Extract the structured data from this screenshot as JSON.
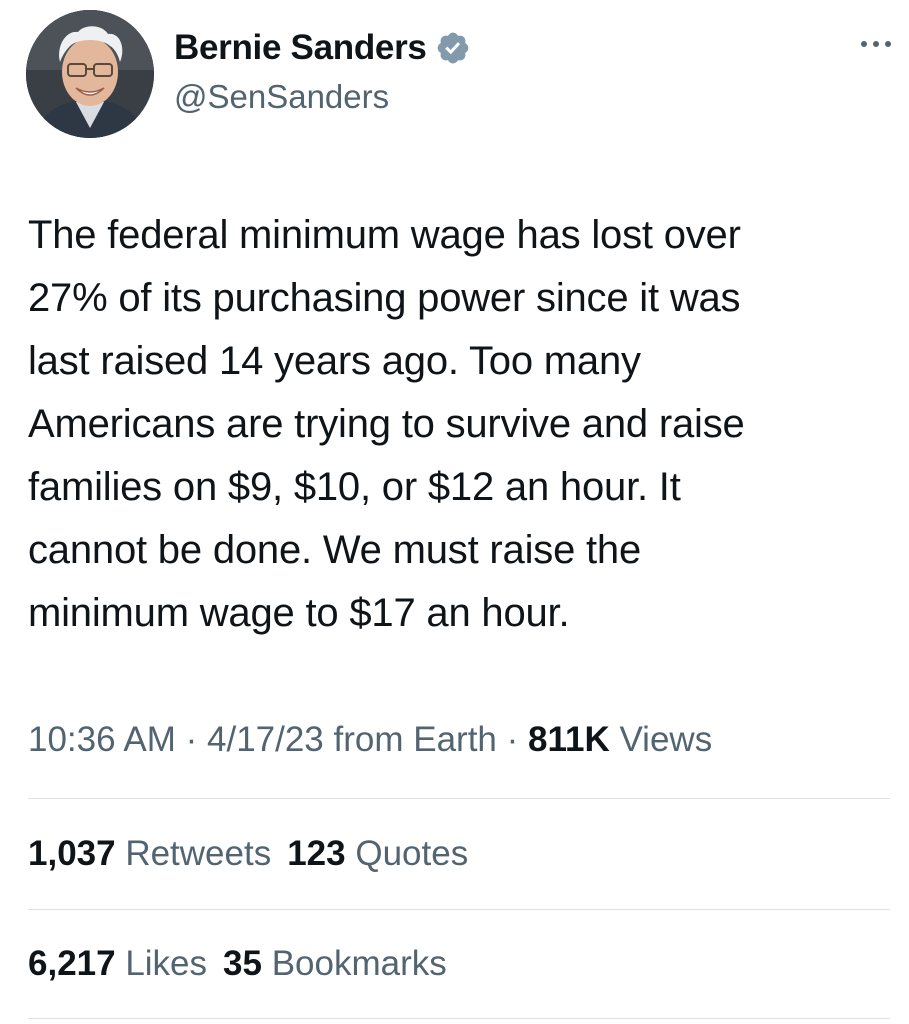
{
  "author": {
    "display_name": "Bernie Sanders",
    "handle": "@SenSanders",
    "verified": true,
    "avatar_icon": "profile-photo"
  },
  "more_icon": "more-horizontal-icon",
  "tweet": {
    "text": "The federal minimum wage has lost over\n27% of its purchasing power since it was\nlast raised 14 years ago. Too many\nAmericans are trying to survive and raise\nfamilies on $9, $10, or $12 an hour. It\ncannot be done. We must raise the\nminimum wage to $17 an hour."
  },
  "meta": {
    "time": "10:36 AM",
    "separator": " · ",
    "date": "4/17/23",
    "source": " from Earth",
    "views_count": "811K",
    "views_label": " Views"
  },
  "stats": {
    "retweets_count": "1,037",
    "retweets_label": " Retweets",
    "quotes_count": "123",
    "quotes_label": " Quotes",
    "likes_count": "6,217",
    "likes_label": " Likes",
    "bookmarks_count": "35",
    "bookmarks_label": " Bookmarks"
  },
  "colors": {
    "text_primary": "#0f1419",
    "text_secondary": "#536471",
    "verified_badge": "#829aab",
    "divider": "#dfe3e6"
  }
}
